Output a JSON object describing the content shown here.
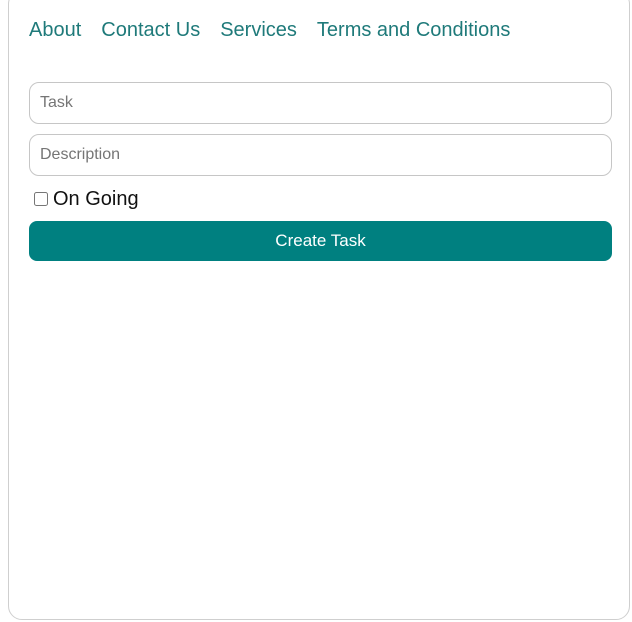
{
  "nav": {
    "items": [
      {
        "label": "About"
      },
      {
        "label": "Contact Us"
      },
      {
        "label": "Services"
      },
      {
        "label": "Terms and Conditions"
      }
    ]
  },
  "form": {
    "task_placeholder": "Task",
    "description_placeholder": "Description",
    "ongoing_label": "On Going",
    "ongoing_checked": false,
    "submit_label": "Create Task"
  },
  "colors": {
    "accent": "#008080",
    "link": "#1f7a7a"
  }
}
